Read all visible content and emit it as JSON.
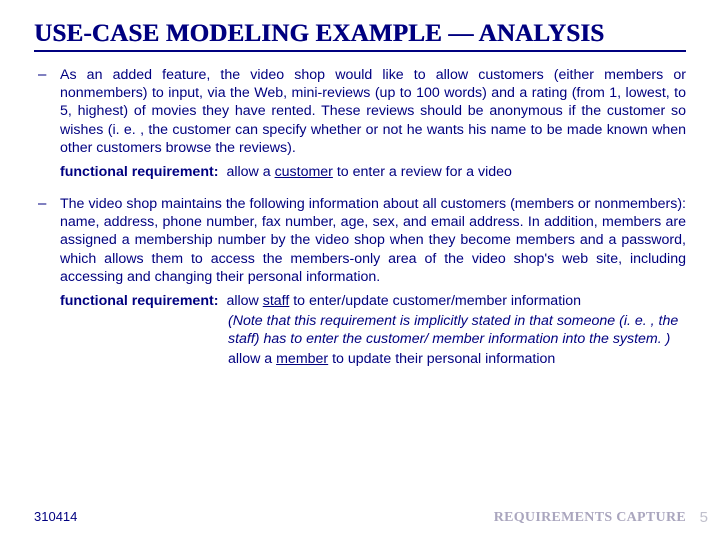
{
  "title": "USE-CASE MODELING EXAMPLE — ANALYSIS",
  "points": [
    {
      "para": "As an added feature, the video shop would like to allow customers (either members or nonmembers) to input, via the Web, mini-reviews (up to 100 words) and a rating (from 1, lowest, to 5, highest) of movies they have rented. These reviews should be anonymous if the customer so wishes (i. e. , the customer can specify whether or not he wants his name to be made known when other customers browse the reviews).",
      "fr_label": "functional requirement:",
      "fr_pre": "allow a ",
      "fr_u": "customer",
      "fr_post": " to enter a review for a video"
    },
    {
      "para": "The video shop maintains the following information about all customers (members or nonmembers): name, address, phone number, fax number, age, sex, and email address. In addition, members are assigned a membership number by the video shop when they become members and a password, which allows them to access the members-only area of the video shop's web site, including accessing and changing their personal information.",
      "fr_label": "functional requirement:",
      "fr_pre": "allow ",
      "fr_u": "staff",
      "fr_post": " to enter/update customer/member information",
      "note": "(Note that this requirement is implicitly stated in that someone (i. e. , the staff) has to enter the customer/ member information into the system. )",
      "fr2_pre": "allow a ",
      "fr2_u": "member",
      "fr2_post": " to update their personal information"
    }
  ],
  "footer": {
    "left": "310414",
    "mid": "REQUIREMENTS CAPTURE",
    "page": "5"
  }
}
